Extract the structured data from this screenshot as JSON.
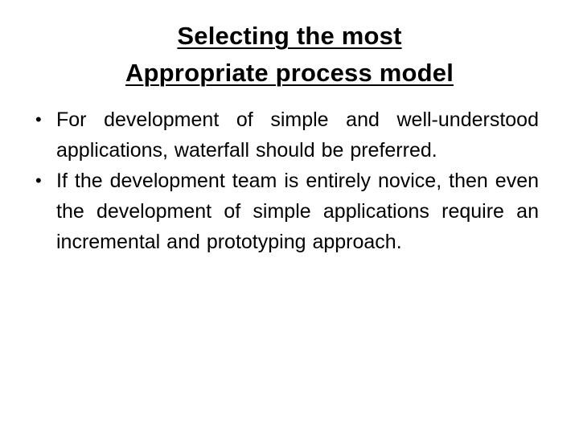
{
  "slide": {
    "title_lines": [
      "Selecting the most",
      "Appropriate process model"
    ],
    "bullet_glyph": "•",
    "bullets": [
      {
        "text": "For development of simple and well-understood applications, waterfall should be preferred."
      },
      {
        "text": "If the development team is entirely novice, then even the development of simple applications require an incremental and prototyping approach."
      }
    ]
  }
}
